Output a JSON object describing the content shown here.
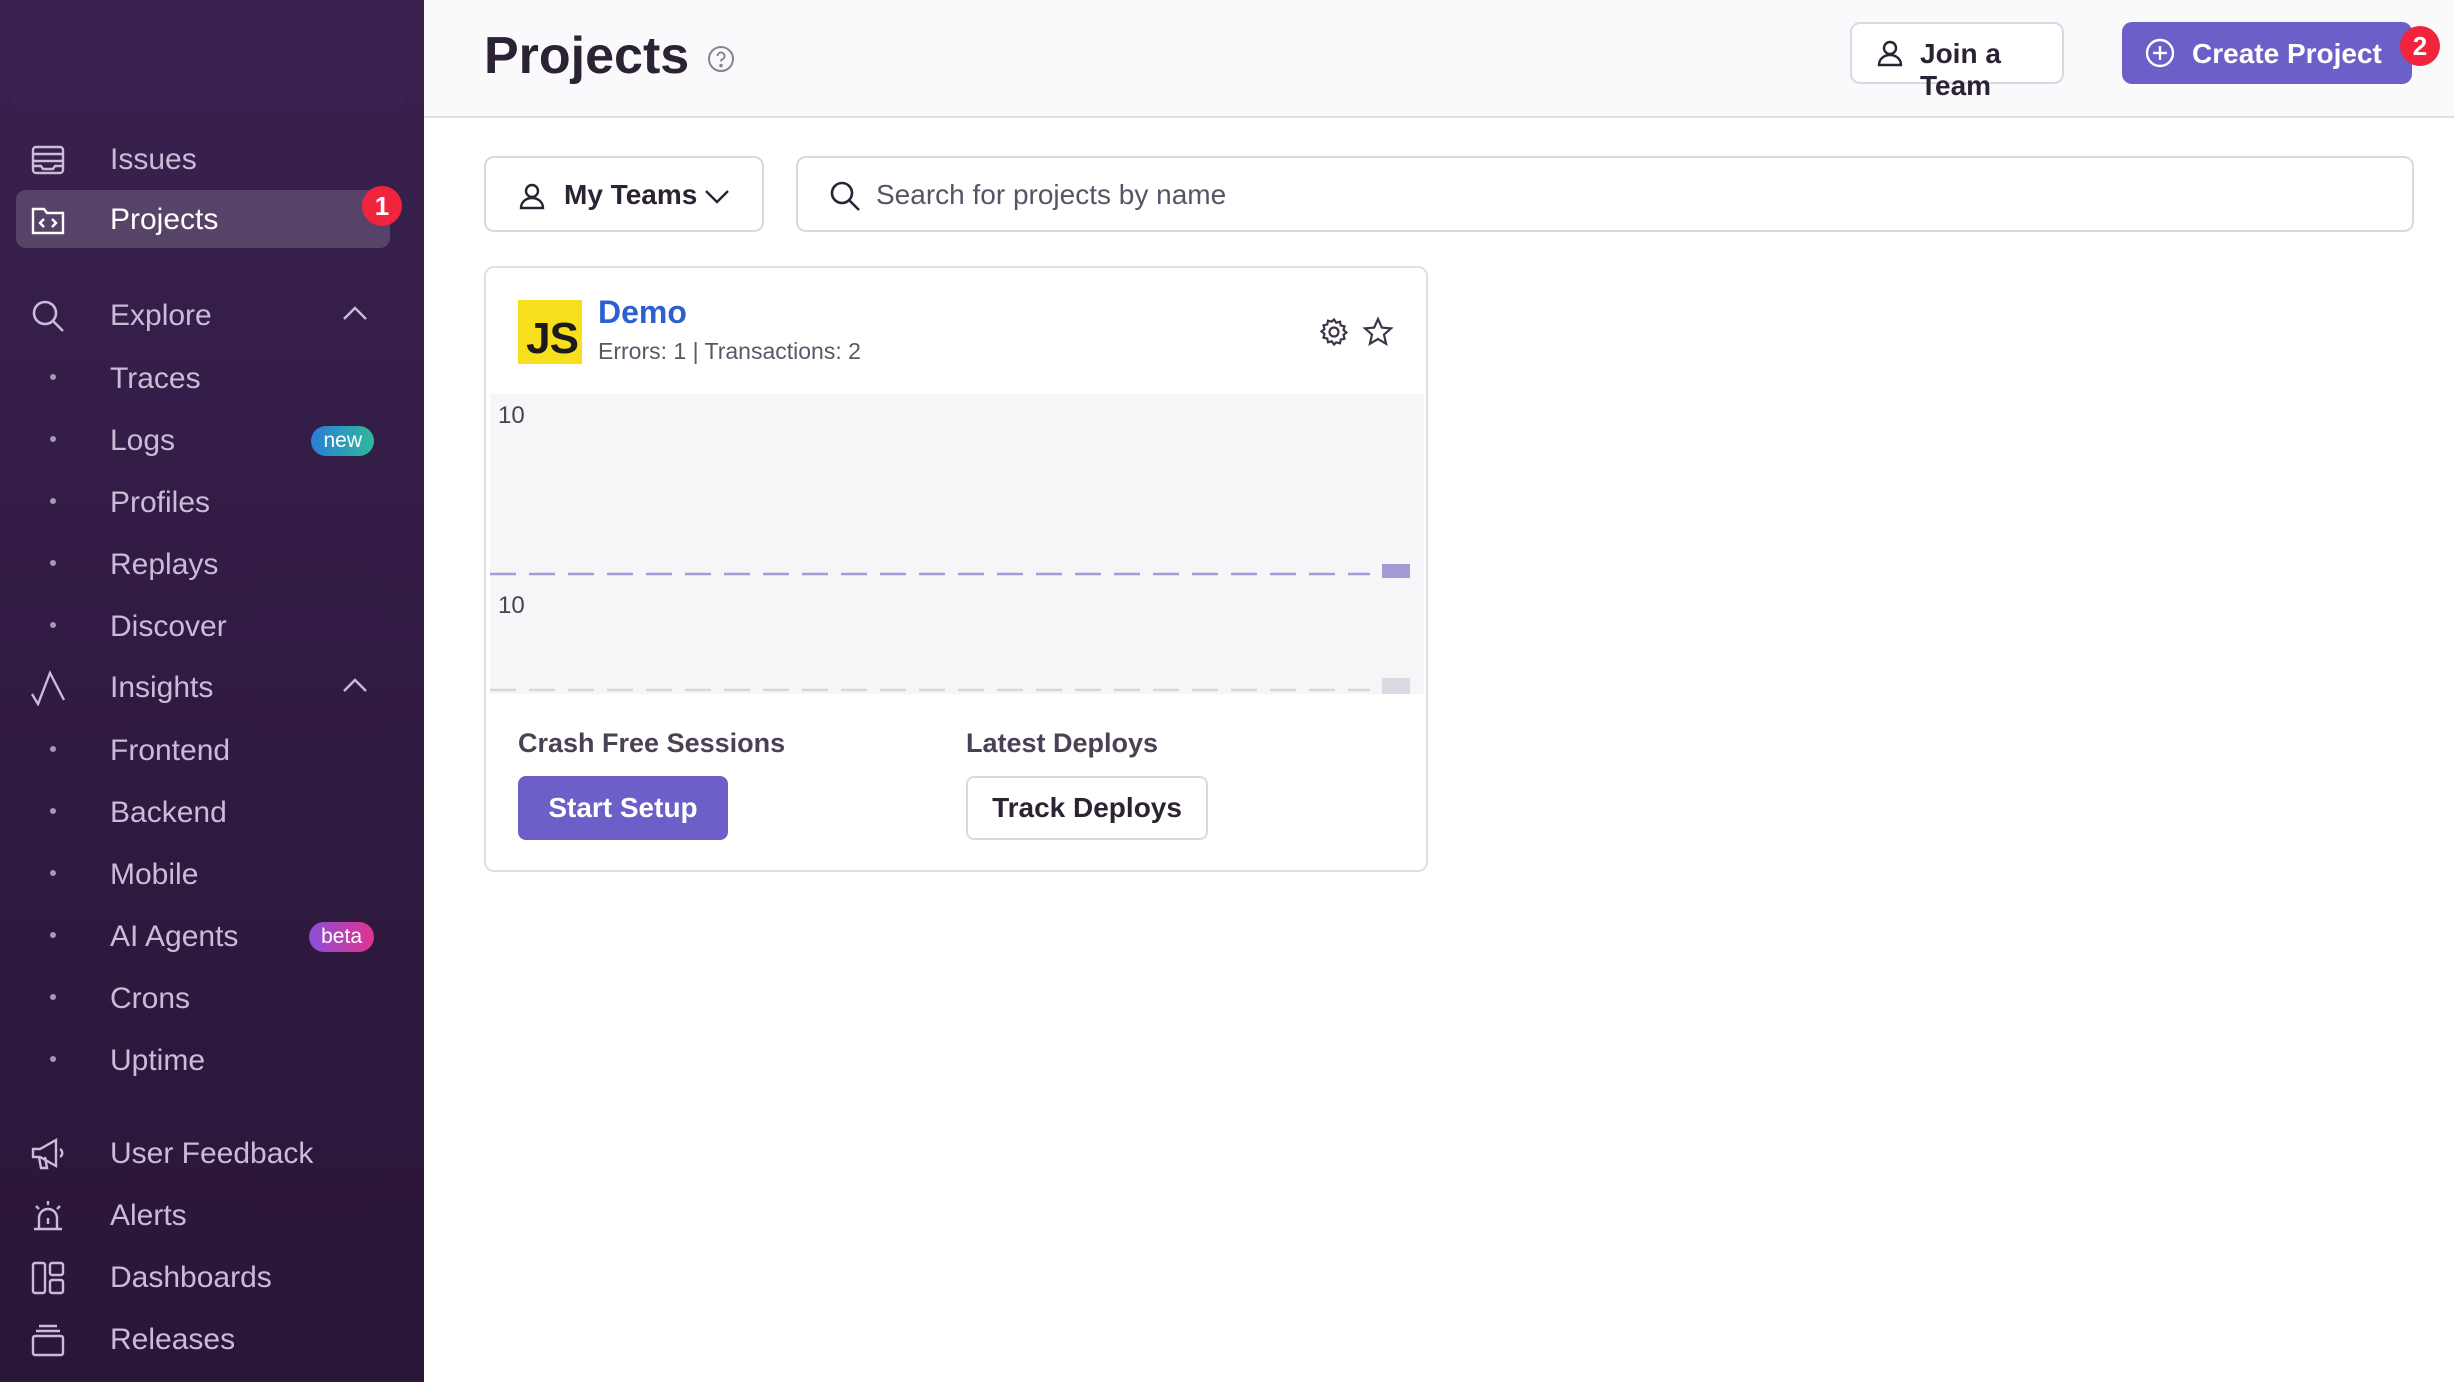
{
  "sidebar": {
    "primary": [
      {
        "label": "Issues",
        "icon": "issues-icon"
      },
      {
        "label": "Projects",
        "icon": "projects-icon",
        "active": true,
        "badge": "1"
      }
    ],
    "explore": {
      "label": "Explore",
      "icon": "search-icon",
      "items": [
        {
          "label": "Traces"
        },
        {
          "label": "Logs",
          "pill": "new"
        },
        {
          "label": "Profiles"
        },
        {
          "label": "Replays"
        },
        {
          "label": "Discover"
        }
      ]
    },
    "insights": {
      "label": "Insights",
      "icon": "insights-icon",
      "items": [
        {
          "label": "Frontend"
        },
        {
          "label": "Backend"
        },
        {
          "label": "Mobile"
        },
        {
          "label": "AI Agents",
          "pill": "beta"
        },
        {
          "label": "Crons"
        },
        {
          "label": "Uptime"
        }
      ]
    },
    "bottom": [
      {
        "label": "User Feedback",
        "icon": "megaphone-icon"
      },
      {
        "label": "Alerts",
        "icon": "siren-icon"
      },
      {
        "label": "Dashboards",
        "icon": "dashboard-icon"
      },
      {
        "label": "Releases",
        "icon": "releases-icon"
      }
    ]
  },
  "header": {
    "title": "Projects",
    "join_team_label": "Join a Team",
    "create_project_label": "Create Project",
    "create_project_badge": "2"
  },
  "filters": {
    "teams_label": "My Teams",
    "search_placeholder": "Search for projects by name"
  },
  "project": {
    "platform_logo": "JS",
    "name": "Demo",
    "stats": "Errors: 1 | Transactions: 2",
    "chart_top_label": "10",
    "chart_bottom_label": "10",
    "crash_free_label": "Crash Free Sessions",
    "setup_button": "Start Setup",
    "deploys_label": "Latest Deploys",
    "track_button": "Track Deploys"
  },
  "colors": {
    "accent": "#6c5fc7",
    "link": "#2c5fcf",
    "badge": "#f0243c",
    "sidebar_bg": "#2f1a41",
    "js_yellow": "#f7df1e"
  }
}
